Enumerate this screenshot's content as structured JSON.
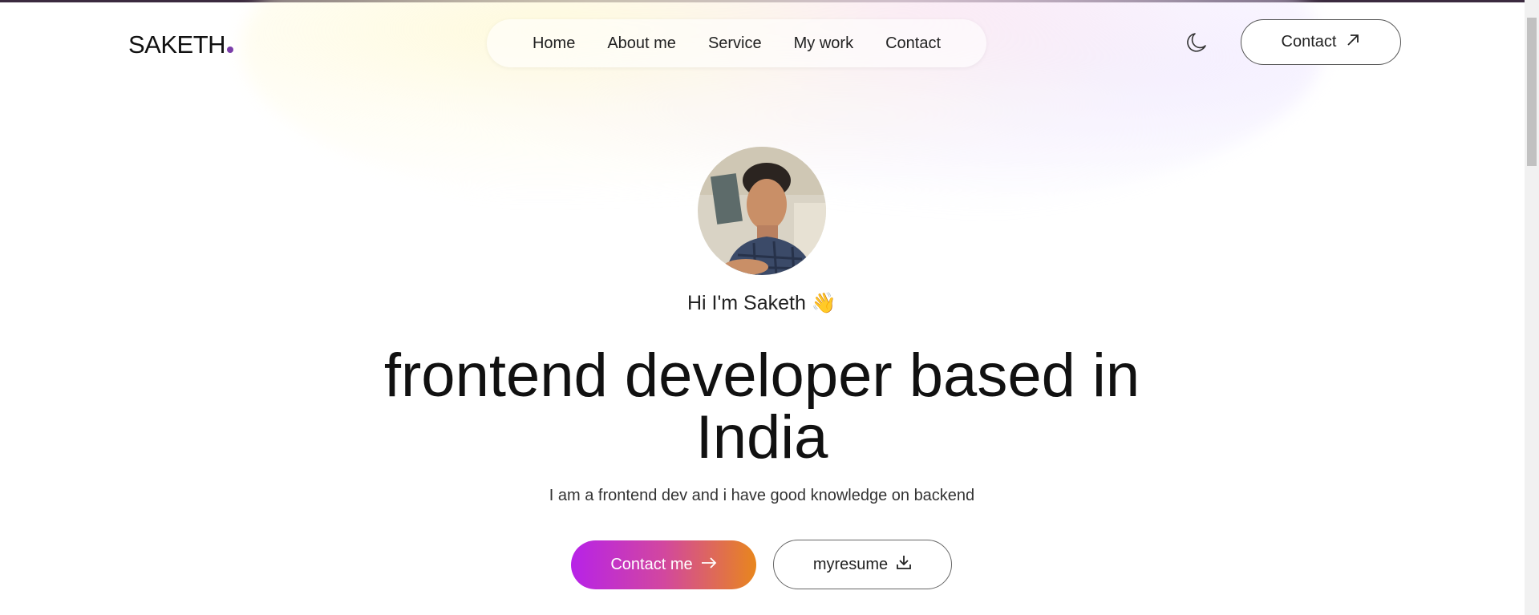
{
  "header": {
    "logo": "SAKETH",
    "nav": [
      "Home",
      "About me",
      "Service",
      "My work",
      "Contact"
    ],
    "theme_icon": "moon-icon",
    "contact_button": "Contact",
    "contact_icon": "arrow-up-right-icon"
  },
  "hero": {
    "greeting": "Hi I'm Saketh",
    "greeting_icon": "waving-hand-icon",
    "headline": "frontend developer based in India",
    "subtitle": "I am a frontend dev and i have good knowledge on backend",
    "cta_button": "Contact me",
    "cta_icon": "arrow-right-icon",
    "resume_button": "myresume",
    "resume_icon": "download-icon"
  },
  "colors": {
    "accent_dot": "#7b3ea9",
    "gradient_start": "#b722e8",
    "gradient_end": "#e8861d"
  }
}
